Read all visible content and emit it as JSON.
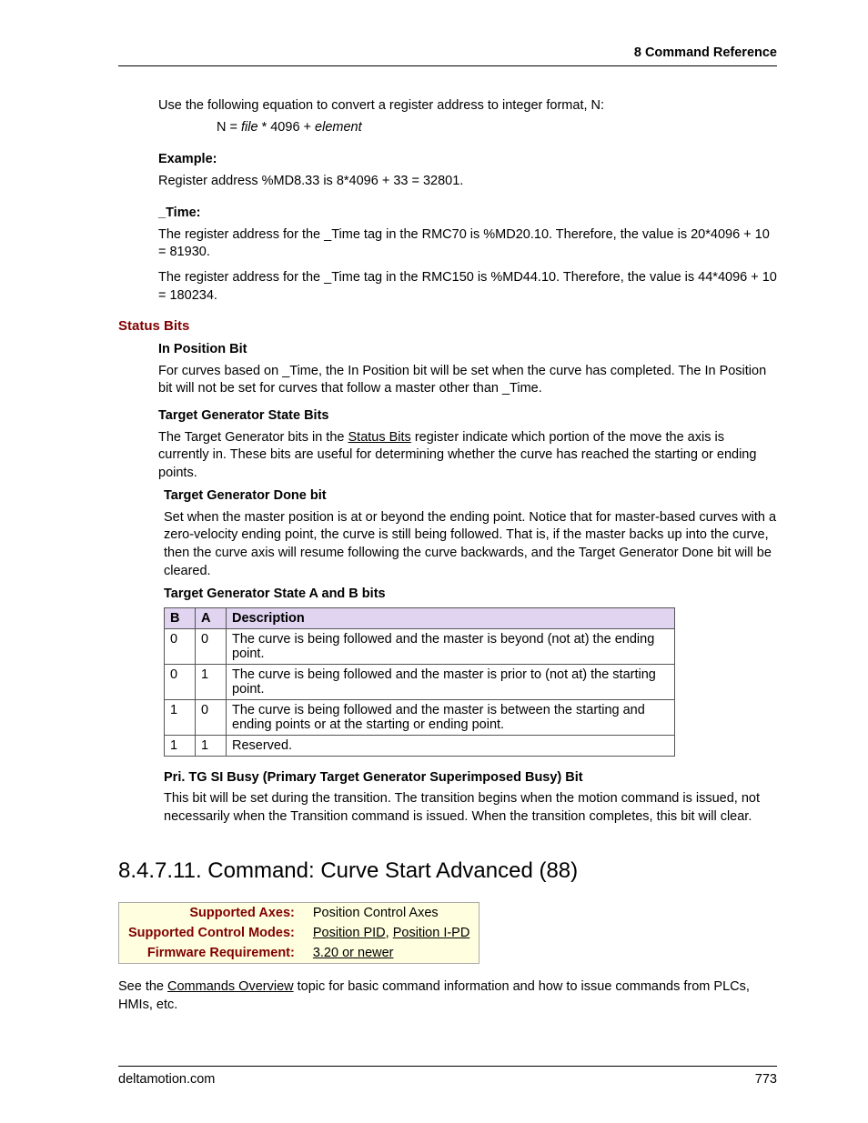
{
  "header": "8  Command Reference",
  "intro": "Use the following equation to convert a register address to integer format, N:",
  "eq_prefix": "N =  ",
  "eq_i1": "file",
  "eq_mid": " * 4096 + ",
  "eq_i2": "element",
  "example_label": "Example:",
  "example_text": "Register address %MD8.33 is 8*4096 + 33 = 32801.",
  "time_label": "_Time:",
  "time_p1": "The register address for the _Time tag in the RMC70 is %MD20.10. Therefore, the value is 20*4096 + 10 = 81930.",
  "time_p2": "The register address for the _Time tag in the RMC150 is %MD44.10. Therefore, the value is 44*4096 + 10 = 180234.",
  "status_bits": "Status Bits",
  "ipb_label": "In Position Bit",
  "ipb_text": "For curves based on _Time, the In Position bit will be set when the curve has completed. The In Position bit will not be set for curves that follow a master other than _Time.",
  "tgsb_label": "Target Generator State Bits",
  "tgsb_p_a": "The Target Generator bits in the ",
  "tgsb_link": "Status Bits",
  "tgsb_p_b": " register indicate which portion of the move the axis is currently in. These bits are useful for determining whether the curve has reached the starting or ending points.",
  "tgdone_label": "Target Generator Done bit",
  "tgdone_text": "Set when the master position is at or beyond the ending point. Notice that for master-based curves with a zero-velocity ending point, the curve is still being followed. That is, if the master backs up into the curve, then the curve axis will resume following the curve backwards, and the Target Generator Done bit will be cleared.",
  "tgab_label": "Target Generator State A and B bits",
  "table": {
    "h_b": "B",
    "h_a": "A",
    "h_desc": "Description",
    "rows": [
      {
        "b": "0",
        "a": "0",
        "d": "The curve is being followed and the master is beyond (not at) the ending point."
      },
      {
        "b": "0",
        "a": "1",
        "d": "The curve is being followed and the master is prior to (not at) the starting point."
      },
      {
        "b": "1",
        "a": "0",
        "d": "The curve is being followed and the master is between the starting and ending points or at the starting or ending point."
      },
      {
        "b": "1",
        "a": "1",
        "d": "Reserved."
      }
    ]
  },
  "tgsi_label": "Pri. TG SI Busy (Primary Target Generator Superimposed Busy) Bit",
  "tgsi_text": "This bit will be set during the transition. The transition begins when the motion command is issued, not necessarily when the Transition command is issued. When the transition completes, this bit will clear.",
  "section_heading": "8.4.7.11. Command: Curve Start Advanced (88)",
  "info": {
    "axes_l": "Supported Axes:",
    "axes_v": "Position Control Axes",
    "modes_l": "Supported Control Modes:",
    "mode_link1": "Position PID",
    "mode_sep": ", ",
    "mode_link2": "Position I-PD",
    "fw_l": "Firmware Requirement:",
    "fw_v": "3.20 or newer"
  },
  "see_a": "See the ",
  "see_link": "Commands Overview",
  "see_b": " topic for basic command information and how to issue commands from PLCs, HMIs, etc.",
  "footer_left": "deltamotion.com",
  "footer_right": "773"
}
